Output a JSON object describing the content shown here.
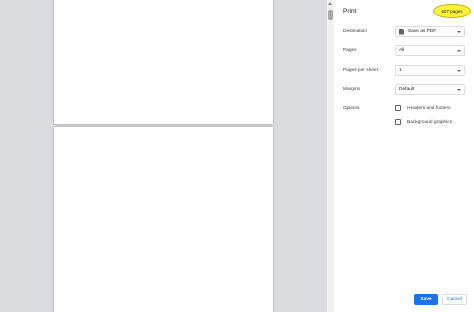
{
  "dialog": {
    "title": "Print",
    "page_count": "507 pages"
  },
  "settings": {
    "destination": {
      "label": "Destination",
      "value": "Save as PDF"
    },
    "pages": {
      "label": "Pages",
      "value": "All"
    },
    "pages_per_sheet": {
      "label": "Pages per sheet",
      "value": "1"
    },
    "margins": {
      "label": "Margins",
      "value": "Default"
    },
    "options": {
      "label": "Options",
      "headers_footers": "Headers and footers",
      "background_graphics": "Background graphics"
    }
  },
  "buttons": {
    "save": "Save",
    "cancel": "Cancel"
  },
  "colors": {
    "highlight": "#fff43a",
    "primary": "#1a73e8"
  }
}
